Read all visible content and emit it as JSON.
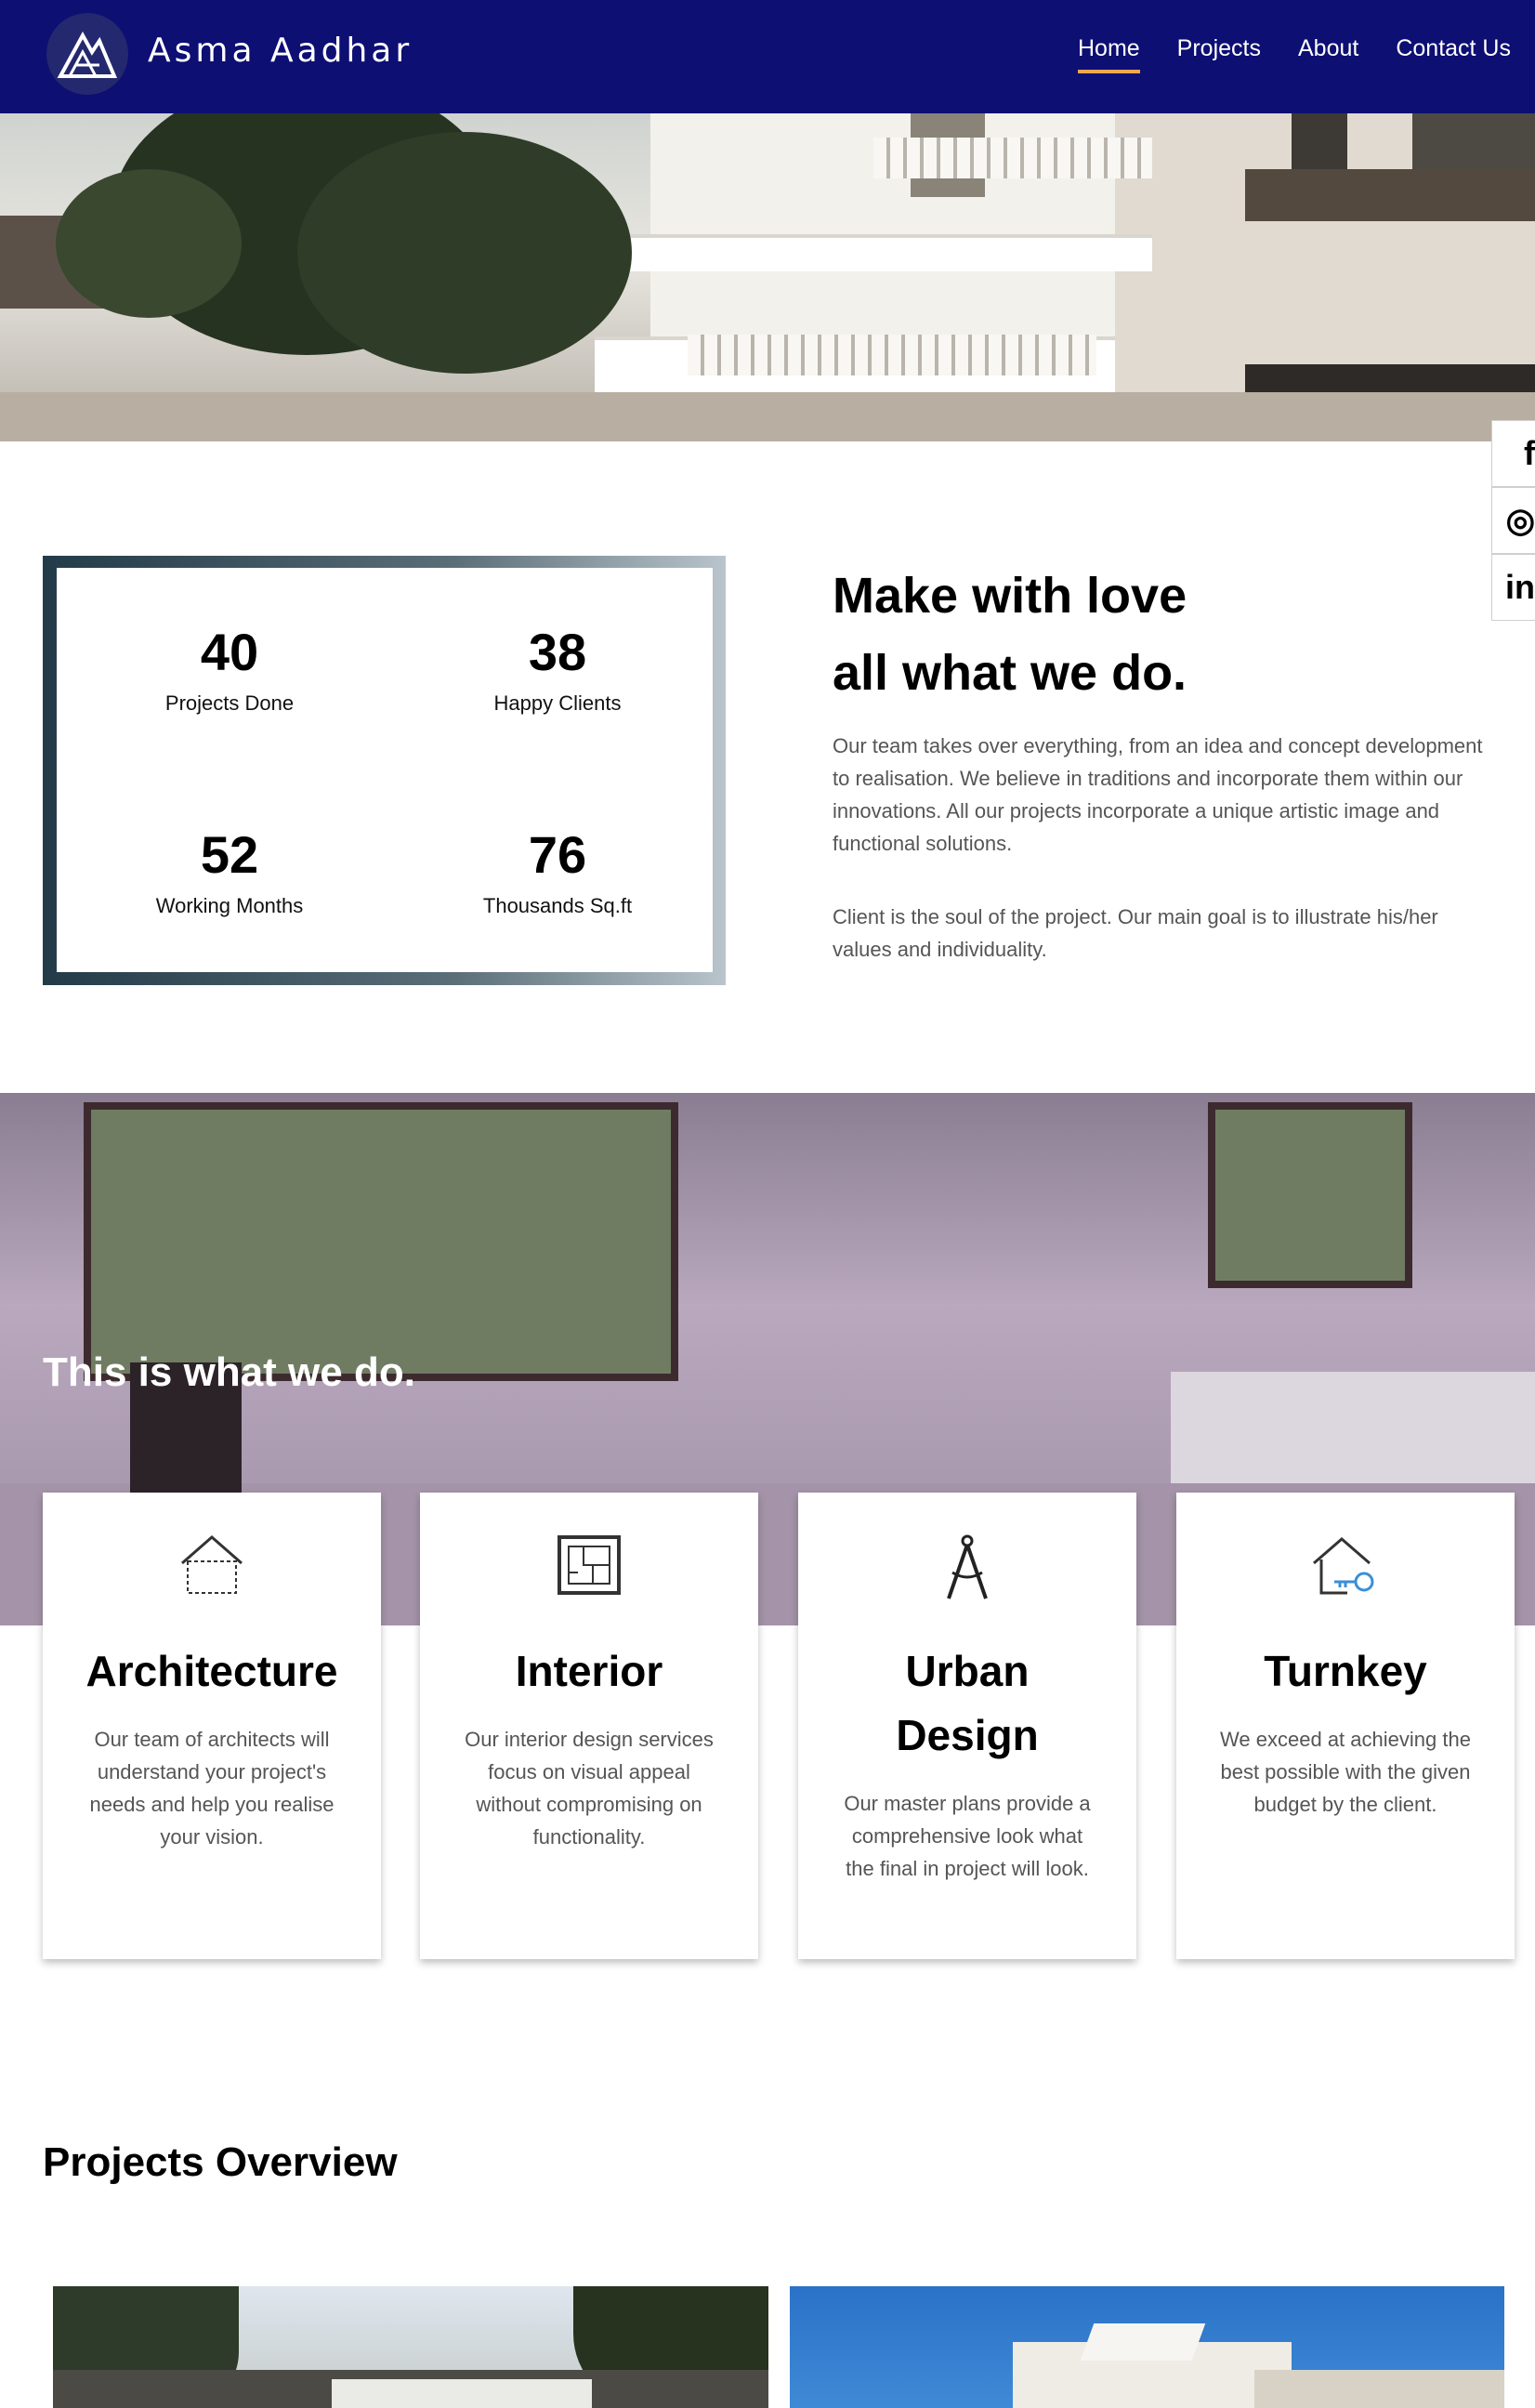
{
  "header": {
    "brand": "Asma Aadhar",
    "nav": [
      {
        "label": "Home",
        "active": true
      },
      {
        "label": "Projects",
        "active": false
      },
      {
        "label": "About",
        "active": false
      },
      {
        "label": "Contact Us",
        "active": false
      }
    ],
    "background_color": "#0d0f73",
    "active_underline_color": "#f0a64e"
  },
  "social": [
    {
      "icon": "facebook-icon",
      "glyph": "f"
    },
    {
      "icon": "instagram-icon",
      "glyph": "◎"
    },
    {
      "icon": "linkedin-icon",
      "glyph": "in"
    }
  ],
  "stats": [
    {
      "value": "40",
      "label": "Projects Done"
    },
    {
      "value": "38",
      "label": "Happy Clients"
    },
    {
      "value": "52",
      "label": "Working Months"
    },
    {
      "value": "76",
      "label": "Thousands Sq.ft"
    }
  ],
  "about": {
    "title_line1": "Make with love",
    "title_line2": "all what we do.",
    "paragraph1": "Our team takes over everything, from an idea and concept development to realisation. We believe in traditions and incorporate them within our innovations. All our projects incorporate a unique artistic image and functional solutions.",
    "paragraph2": "Client is the soul of the project. Our main goal is to illustrate his/her values and individuality."
  },
  "services": {
    "title": "This is what we do.",
    "cards": [
      {
        "icon": "house-icon",
        "title": "Architecture",
        "description": "Our team of architects will understand your project's needs and help you realise your vision."
      },
      {
        "icon": "floorplan-icon",
        "title": "Interior",
        "description": "Our interior design services focus on visual appeal without compromising on functionality."
      },
      {
        "icon": "compass-icon",
        "title": "Urban Design",
        "description": "Our master plans provide a comprehensive look what the final in project will look."
      },
      {
        "icon": "house-key-icon",
        "title": "Turnkey",
        "description": "We exceed at achieving the best possible with the given budget by the client."
      }
    ]
  },
  "projects": {
    "title": "Projects Overview"
  }
}
